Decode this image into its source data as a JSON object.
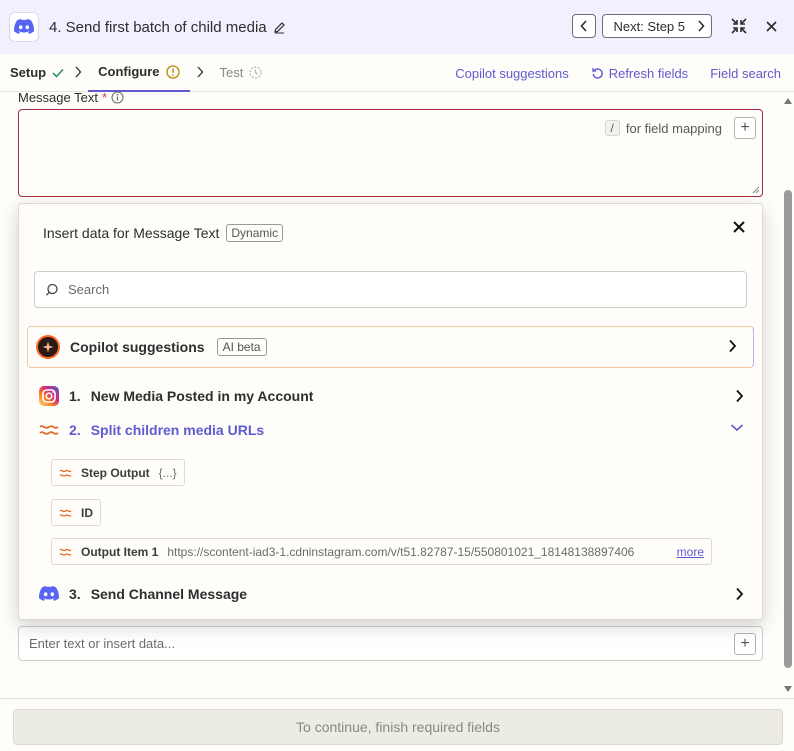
{
  "header": {
    "title": "4. Send first batch of child media",
    "next_label": "Next: Step 5"
  },
  "tabs": {
    "setup": "Setup",
    "configure": "Configure",
    "test": "Test"
  },
  "links": {
    "copilot": "Copilot suggestions",
    "refresh": "Refresh fields",
    "field_search": "Field search"
  },
  "field": {
    "label": "Message Text",
    "required_mark": "*",
    "slash_key": "/",
    "mapping_hint": "for field mapping",
    "plus": "+"
  },
  "popup": {
    "title": "Insert data for Message Text",
    "badge": "Dynamic",
    "search_placeholder": "Search",
    "copilot": {
      "label": "Copilot suggestions",
      "badge": "AI beta"
    },
    "steps": [
      {
        "num": "1.",
        "name": "New Media Posted in my Account",
        "icon": "instagram-icon"
      },
      {
        "num": "2.",
        "name": "Split children media URLs",
        "icon": "formatter-icon",
        "expanded": true
      },
      {
        "num": "3.",
        "name": "Send Channel Message",
        "icon": "discord-icon"
      }
    ],
    "fields": [
      {
        "key": "Step Output",
        "value": "{...}"
      },
      {
        "key": "ID",
        "value": ""
      },
      {
        "key": "Output Item 1",
        "value": "https://scontent-iad3-1.cdninstagram.com/v/t51.82787-15/550801021_18148138897406",
        "more": "more"
      }
    ]
  },
  "input": {
    "placeholder": "Enter text or insert data...",
    "plus": "+"
  },
  "footer": {
    "button": "To continue, finish required fields"
  },
  "colors": {
    "accent": "#5f5ad0",
    "header_bg": "#f2f0ff",
    "error_border": "#a72f3d",
    "formatter": "#e26a2c"
  }
}
